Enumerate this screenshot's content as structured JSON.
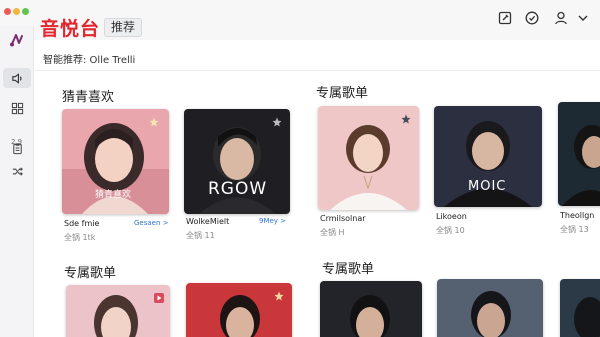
{
  "window": {
    "title": "音悦台",
    "tag": "推荐",
    "subtitle": "智能推荐: Olle Trelli"
  },
  "header_icons": [
    "edit-icon",
    "check-circle-icon",
    "user-icon",
    "chevron-down-icon"
  ],
  "sidebar": {
    "items": [
      "music-note-logo-icon",
      "speaker-icon",
      "grid-icon",
      "clipboard-icon",
      "shuffle-icon"
    ],
    "sub_label": "2 9"
  },
  "sections": {
    "row1_left": "猜青喜欢",
    "row1_right": "专属歌单",
    "row2_left": "专属歌单",
    "row2_right": "专属歌单"
  },
  "cards": [
    {
      "name": "Sde fmie",
      "meta": "全锅 1tk",
      "link": "Gesaen >",
      "overlay": "猜青喜欢"
    },
    {
      "name": "WolkeMielt",
      "meta": "全锅 11",
      "link": "9Mey >",
      "overlay": "RGOW"
    },
    {
      "name": "Crmilsolnar",
      "meta": "全锅 H",
      "link": "",
      "overlay": ""
    },
    {
      "name": "Likoeon",
      "meta": "全锅 10",
      "link": "",
      "overlay": "MOIC"
    },
    {
      "name": "Theollgn",
      "meta": "全锅 13",
      "link": "",
      "overlay": ""
    }
  ],
  "colors": {
    "brand": "#e0262e",
    "link": "#2f74d0"
  }
}
